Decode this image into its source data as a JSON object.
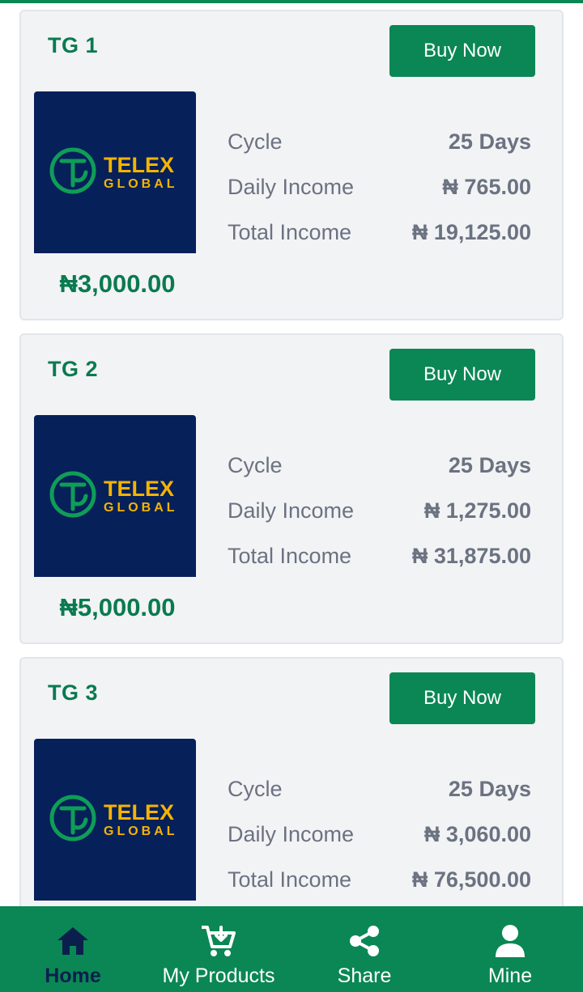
{
  "brand": {
    "logo_text_top": "TELEX",
    "logo_text_bottom": "GLOBAL",
    "colors": {
      "primary": "#0a8754",
      "navy": "#06205a",
      "gold": "#f5b400",
      "logo_green": "#0f9d58"
    }
  },
  "products": [
    {
      "name": "TG 1",
      "buy_label": "Buy Now",
      "price": "₦3,000.00",
      "stats": [
        {
          "label": "Cycle",
          "value": "25 Days"
        },
        {
          "label": "Daily Income",
          "value": "₦ 765.00"
        },
        {
          "label": "Total Income",
          "value": "₦ 19,125.00"
        }
      ]
    },
    {
      "name": "TG 2",
      "buy_label": "Buy Now",
      "price": "₦5,000.00",
      "stats": [
        {
          "label": "Cycle",
          "value": "25 Days"
        },
        {
          "label": "Daily Income",
          "value": "₦ 1,275.00"
        },
        {
          "label": "Total Income",
          "value": "₦ 31,875.00"
        }
      ]
    },
    {
      "name": "TG 3",
      "buy_label": "Buy Now",
      "price": "",
      "stats": [
        {
          "label": "Cycle",
          "value": "25 Days"
        },
        {
          "label": "Daily Income",
          "value": "₦ 3,060.00"
        },
        {
          "label": "Total Income",
          "value": "₦ 76,500.00"
        }
      ]
    }
  ],
  "nav": {
    "items": [
      {
        "label": "Home",
        "icon": "home-icon",
        "active": true
      },
      {
        "label": "My Products",
        "icon": "cart-icon",
        "active": false
      },
      {
        "label": "Share",
        "icon": "share-icon",
        "active": false
      },
      {
        "label": "Mine",
        "icon": "user-icon",
        "active": false
      }
    ]
  }
}
